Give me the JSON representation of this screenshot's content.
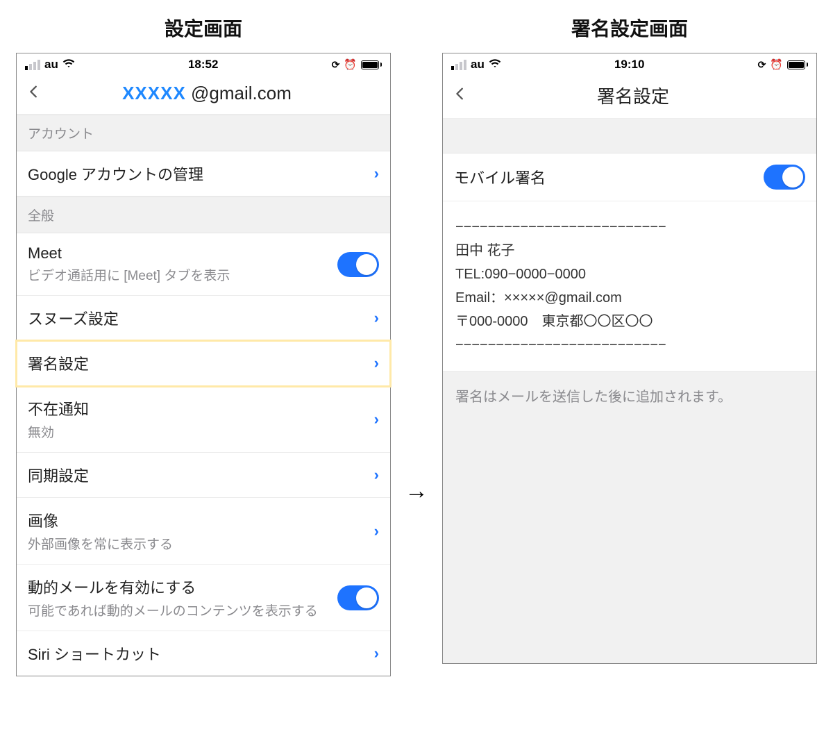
{
  "left": {
    "col_title": "設定画面",
    "status": {
      "carrier": "au",
      "time": "18:52"
    },
    "nav": {
      "title_masked": "XXXXX",
      "title_domain": " @gmail.com"
    },
    "sections": {
      "account_header": "アカウント",
      "manage_google": "Google アカウントの管理",
      "general_header": "全般",
      "meet_title": "Meet",
      "meet_sub": "ビデオ通話用に [Meet] タブを表示",
      "snooze": "スヌーズ設定",
      "signature": "署名設定",
      "ooo_title": "不在通知",
      "ooo_sub": "無効",
      "sync": "同期設定",
      "images_title": "画像",
      "images_sub": "外部画像を常に表示する",
      "dynamic_title": "動的メールを有効にする",
      "dynamic_sub": "可能であれば動的メールのコンテンツを表示する",
      "siri": "Siri ショートカット"
    }
  },
  "right": {
    "col_title": "署名設定画面",
    "status": {
      "carrier": "au",
      "time": "19:10"
    },
    "nav": {
      "title": "署名設定"
    },
    "mobile_sig_label": "モバイル署名",
    "signature_lines": [
      "−−−−−−−−−−−−−−−−−−−−−−−−−−",
      "田中 花子",
      "TEL:090−0000−0000",
      "Email：×××××@gmail.com",
      "〒000-0000　東京都〇〇区〇〇",
      "−−−−−−−−−−−−−−−−−−−−−−−−−−"
    ],
    "note": "署名はメールを送信した後に追加されます。"
  },
  "arrow": "→"
}
